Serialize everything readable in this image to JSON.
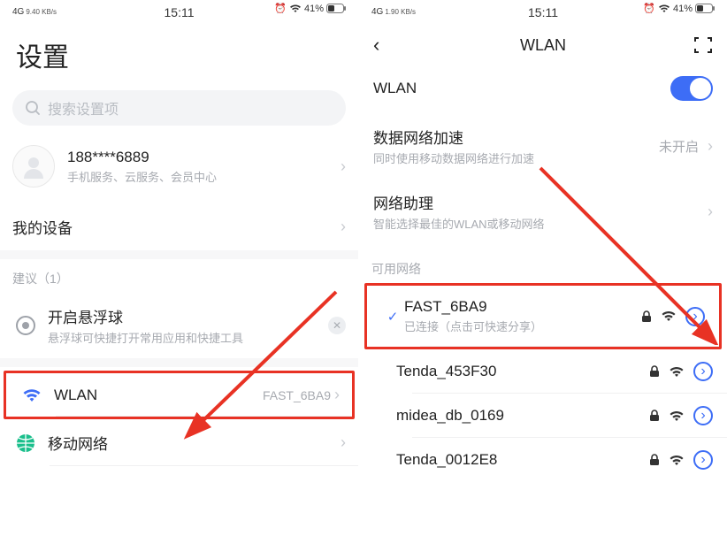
{
  "left": {
    "status": {
      "sig": "4G",
      "speed": "9.40\nKB/s",
      "time": "15:11",
      "battery": "41%"
    },
    "title": "设置",
    "search_placeholder": "搜索设置项",
    "account": {
      "phone": "188****6889",
      "sub": "手机服务、云服务、会员中心"
    },
    "my_device": "我的设备",
    "suggest_label": "建议（1）",
    "suggest": {
      "title": "开启悬浮球",
      "sub": "悬浮球可快捷打开常用应用和快捷工具"
    },
    "wlan": {
      "label": "WLAN",
      "value": "FAST_6BA9"
    },
    "cellular": "移动网络"
  },
  "right": {
    "status": {
      "sig": "4G",
      "speed": "1.90\nKB/s",
      "time": "15:11",
      "battery": "41%"
    },
    "header": "WLAN",
    "wlan_switch_label": "WLAN",
    "accel": {
      "title": "数据网络加速",
      "sub": "同时使用移动数据网络进行加速",
      "value": "未开启"
    },
    "assistant": {
      "title": "网络助理",
      "sub": "智能选择最佳的WLAN或移动网络"
    },
    "avail_label": "可用网络",
    "networks": [
      {
        "name": "FAST_6BA9",
        "sub": "已连接（点击可快速分享）",
        "connected": true,
        "locked": true
      },
      {
        "name": "Tenda_453F30",
        "sub": "",
        "connected": false,
        "locked": true
      },
      {
        "name": "midea_db_0169",
        "sub": "",
        "connected": false,
        "locked": true
      },
      {
        "name": "Tenda_0012E8",
        "sub": "",
        "connected": false,
        "locked": true
      }
    ]
  }
}
